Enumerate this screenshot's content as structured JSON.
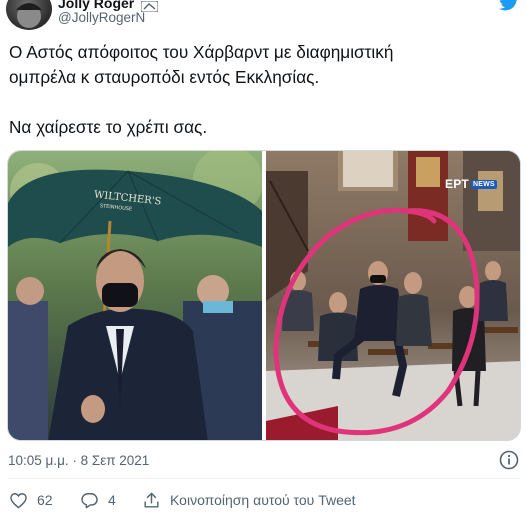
{
  "header": {
    "display_name": "Jolly Roger",
    "username": "@JollyRogerN"
  },
  "tweet": {
    "line1": "Ο Αστός απόφοιτος του Χάρβαρντ με διαφημιστική",
    "line2": "ομπρέλα κ σταυροπόδι εντός Εκκλησίας.",
    "line3": "Να χαίρεστε το χρέπι σας."
  },
  "media": {
    "umbrella_text": "WILTCHER'S",
    "umbrella_subtext": "STEINHOUSE",
    "broadcast_logo": "ΕΡΤ",
    "broadcast_badge": "NEWS"
  },
  "meta": {
    "timestamp": "10:05 μ.μ. · 8 Σεπ 2021"
  },
  "actions": {
    "likes": "62",
    "replies": "4",
    "share_label": "Κοινοποίηση αυτού του Tweet"
  },
  "colors": {
    "text": "#0f1419",
    "secondary": "#536471",
    "brand": "#1d9bf0",
    "circle_annotation": "#e0347a"
  }
}
